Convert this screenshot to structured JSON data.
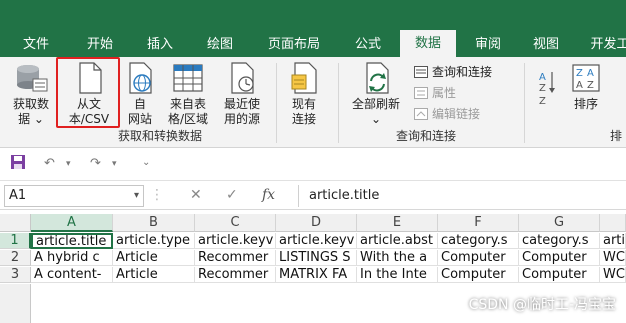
{
  "tabs": [
    {
      "label": "文件"
    },
    {
      "label": "开始"
    },
    {
      "label": "插入"
    },
    {
      "label": "绘图"
    },
    {
      "label": "页面布局"
    },
    {
      "label": "公式"
    },
    {
      "label": "数据",
      "active": true
    },
    {
      "label": "审阅"
    },
    {
      "label": "视图"
    },
    {
      "label": "开发工"
    }
  ],
  "ribbon": {
    "get_data": {
      "line1": "获取数",
      "line2": "据 ⌄"
    },
    "from_text": {
      "line1": "从文",
      "line2": "本/CSV"
    },
    "from_web": {
      "line1": "自",
      "line2": "网站"
    },
    "from_table": {
      "line1": "来自表",
      "line2": "格/区域"
    },
    "recent_sources": {
      "line1": "最近使",
      "line2": "用的源"
    },
    "existing_conn": {
      "line1": "现有",
      "line2": "连接"
    },
    "refresh_all": {
      "line1": "全部刷新",
      "line2": "⌄"
    },
    "queries_connections": "查询和连接",
    "properties": "属性",
    "edit_links": "编辑链接",
    "sort": "排序",
    "group_get_transform": "获取和转换数据",
    "group_queries": "查询和连接",
    "group_sort_partial": "排"
  },
  "qat": {
    "save_icon": "save-icon",
    "undo": "↶",
    "redo": "↷",
    "more": "⌄"
  },
  "formula_bar": {
    "name_box": "A1",
    "cancel": "✕",
    "enter": "✓",
    "fx": "fx",
    "content": "article.title"
  },
  "grid": {
    "columns": [
      "A",
      "B",
      "C",
      "D",
      "E",
      "F",
      "G"
    ],
    "partial_col": "",
    "rows": [
      {
        "num": "1",
        "cells": [
          "article.title",
          "article.type",
          "article.keyv",
          "article.keyv",
          "article.abst",
          "category.s",
          "category.s",
          "arti"
        ]
      },
      {
        "num": "2",
        "cells": [
          "A hybrid c",
          "Article",
          "Recommer",
          "LISTINGS S",
          "With the a",
          "Computer",
          "Computer",
          "WC"
        ]
      },
      {
        "num": "3",
        "cells": [
          "A content-",
          "Article",
          "Recommer",
          "MATRIX FA",
          "In the Inte",
          "Computer",
          "Computer",
          "WC"
        ]
      }
    ]
  },
  "watermark": "CSDN @临时工-冯宝宝",
  "colors": {
    "accent": "#217346",
    "highlight": "#e02020"
  }
}
